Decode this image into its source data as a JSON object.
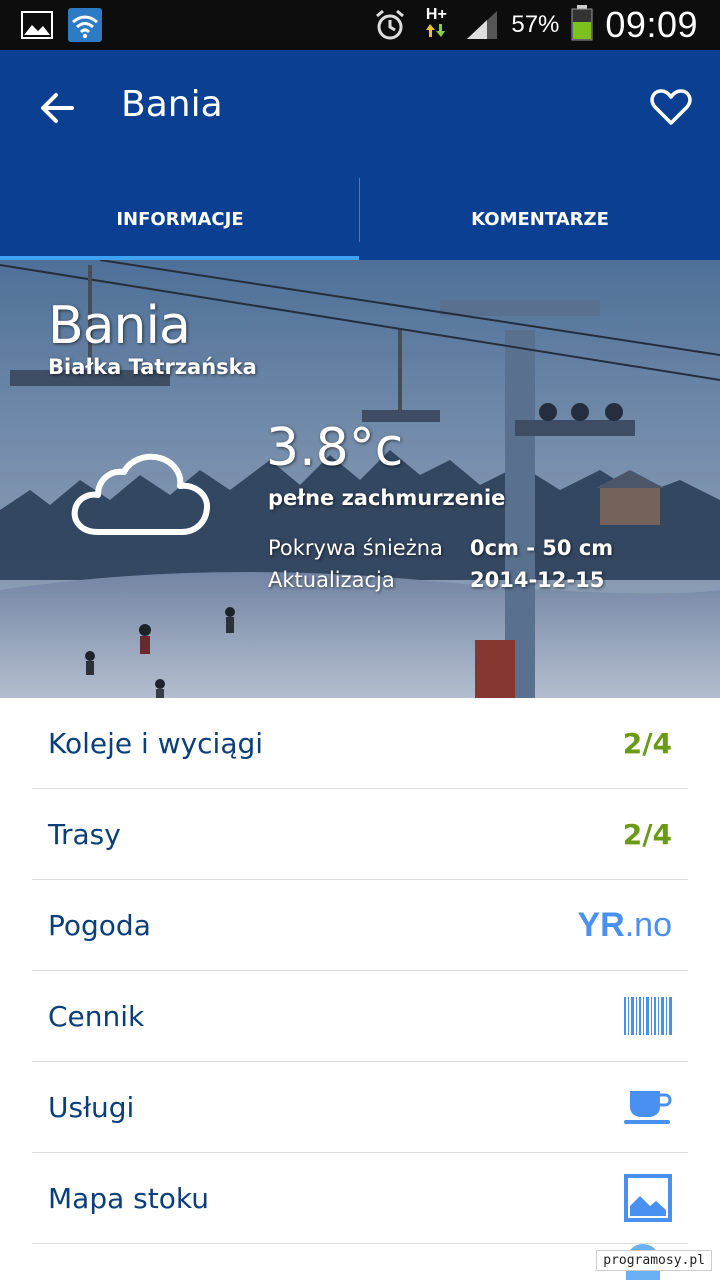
{
  "status_bar": {
    "battery_percent": "57%",
    "time": "09:09",
    "network": "H+"
  },
  "app_bar": {
    "title": "Bania",
    "tabs": [
      {
        "label": "INFORMACJE",
        "active": true
      },
      {
        "label": "KOMENTARZE",
        "active": false
      }
    ]
  },
  "hero": {
    "name": "Bania",
    "location": "Białka Tatrzańska",
    "temperature": "3.8°c",
    "condition": "pełne zachmurzenie",
    "snow_label": "Pokrywa śnieżna",
    "snow_value": "0cm - 50 cm",
    "update_label": "Aktualizacja",
    "update_value": "2014-12-15",
    "weather_icon": "cloud-icon"
  },
  "list": {
    "items": [
      {
        "label": "Koleje i wyciągi",
        "value": "2/4"
      },
      {
        "label": "Trasy",
        "value": "2/4"
      },
      {
        "label": "Pogoda",
        "brand": "YR.no",
        "brand_bold": "YR",
        "brand_rest": ".no"
      },
      {
        "label": "Cennik",
        "icon": "barcode-icon"
      },
      {
        "label": "Usługi",
        "icon": "coffee-cup-icon"
      },
      {
        "label": "Mapa stoku",
        "icon": "image-icon"
      }
    ]
  },
  "watermark": "programosy.pl",
  "colors": {
    "primary": "#0b3f91",
    "accent": "#3ea2f5",
    "value_green": "#6a9a16",
    "label_blue": "#0b3f7a",
    "icon_blue": "#4a90f0"
  }
}
